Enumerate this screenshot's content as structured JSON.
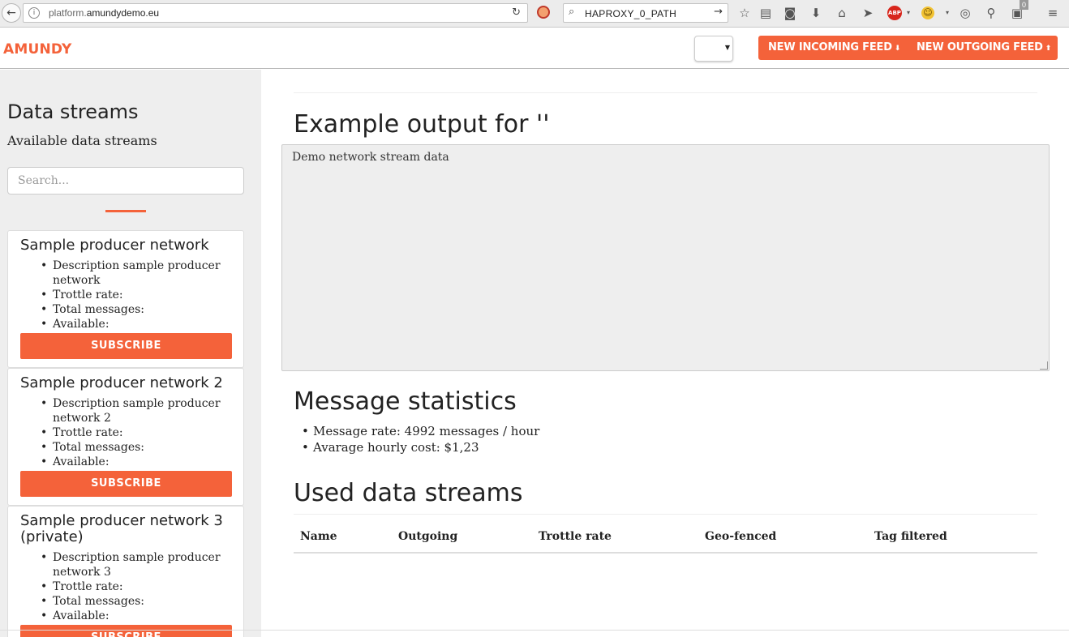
{
  "browser": {
    "url_prefix": "platform.",
    "url_domain": "amundydemo.eu",
    "search_text": "HAPROXY_0_PATH",
    "badge_count": "0"
  },
  "header": {
    "brand": "AMUNDY",
    "incoming_label": "NEW INCOMING FEED",
    "outgoing_label": "NEW OUTGOING FEED",
    "incoming_arrow": "⬇",
    "outgoing_arrow": "⬆"
  },
  "sidebar": {
    "title": "Data streams",
    "subtitle": "Available data streams",
    "search_placeholder": "Search...",
    "streams": [
      {
        "name": "Sample producer network",
        "description": "Description sample producer network",
        "throttle": "Trottle rate:",
        "total": "Total messages:",
        "available": "Available:",
        "button": "SUBSCRIBE"
      },
      {
        "name": "Sample producer network 2",
        "description": "Description sample producer network 2",
        "throttle": "Trottle rate:",
        "total": "Total messages:",
        "available": "Available:",
        "button": "SUBSCRIBE"
      },
      {
        "name": "Sample producer network 3 (private)",
        "description": "Description sample producer network 3",
        "throttle": "Trottle rate:",
        "total": "Total messages:",
        "available": "Available:",
        "button": "SUBSCRIBE"
      }
    ]
  },
  "main": {
    "example_heading": "Example output for ''",
    "example_output": "Demo network stream data",
    "stats_heading": "Message statistics",
    "message_rate": "Message rate: 4992 messages / hour",
    "hourly_cost": "Avarage hourly cost: $1,23",
    "used_heading": "Used data streams",
    "table_headers": [
      "Name",
      "Outgoing",
      "Trottle rate",
      "Geo-fenced",
      "Tag filtered"
    ]
  },
  "colors": {
    "accent": "#f4623a",
    "sidebar_bg": "#eeeeee"
  }
}
